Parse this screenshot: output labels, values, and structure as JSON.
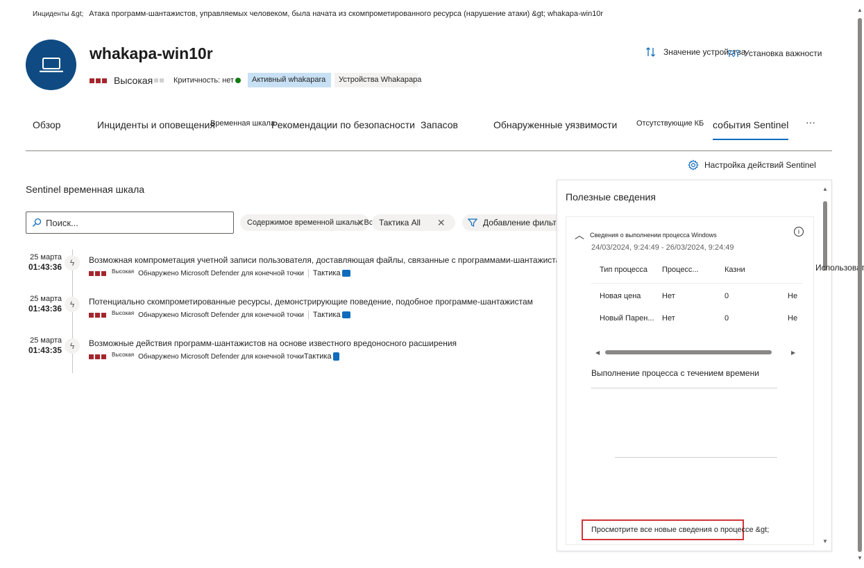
{
  "breadcrumb": {
    "root": "Инциденты &gt;",
    "path": "Атака программ-шантажистов, управляемых человеком, была начата из скомпрометированного ресурса (нарушение атаки) &gt; whakapa-win10r"
  },
  "device": {
    "name": "whakapa-win10r",
    "severity": "Высокая",
    "criticality": "Критичность: нет",
    "tag_active": "Активный whakapara",
    "tag_devices": "Устройства Whakapapa"
  },
  "actions": {
    "device_value": "Значение устройства",
    "set_importance": "Установка важности"
  },
  "tabs": [
    {
      "label": "Обзор"
    },
    {
      "label": "Инциденты и оповещения"
    },
    {
      "label": "Временная шкала"
    },
    {
      "label": "Рекомендации по безопасности"
    },
    {
      "label": "Запасов"
    },
    {
      "label": "Обнаруженные уязвимости"
    },
    {
      "label": "Отсутствующие КБ"
    },
    {
      "label": "события Sentinel"
    },
    {
      "label": "···"
    }
  ],
  "sentinel_settings": "Настройка действий Sentinel",
  "timeline": {
    "title": "Sentinel временная шкала",
    "search_placeholder": "Поиск...",
    "filter_content": "Содержимое временной шкалы: Все",
    "filter_tactic": "Тактика All",
    "add_filter": "Добавление фильтра",
    "entries": [
      {
        "date": "25 марта",
        "time": "01:43:36",
        "title": "Возможная компрометация учетной записи пользователя, доставляющая файлы, связанные с программами-шантажистами",
        "severity": "Высокая",
        "detected": "Обнаружено Microsoft Defender для конечной точки",
        "tactic": "Тактика"
      },
      {
        "date": "25 марта",
        "time": "01:43:36",
        "title": "Потенциально скомпрометированные ресурсы, демонстрирующие поведение, подобное программе-шантажистам",
        "severity": "Высокая",
        "detected": "Обнаружено Microsoft Defender для конечной точки",
        "tactic": "Тактика"
      },
      {
        "date": "25 марта",
        "time": "01:43:35",
        "title": "Возможные действия программ-шантажистов на основе известного вредоносного расширения",
        "severity": "Высокая",
        "detected": "Обнаружено Microsoft Defender для конечной точки",
        "tactic": "Тактика"
      }
    ]
  },
  "insights": {
    "title": "Полезные сведения",
    "card_title": "Сведения о выполнении процесса Windows",
    "range": "24/03/2024, 9:24:49 - 26/03/2024, 9:24:49",
    "columns": [
      "Тип процесса",
      "Процесс...",
      "Казни",
      "Использовать"
    ],
    "rows": [
      [
        "Новая цена",
        "Нет",
        "0",
        "Не"
      ],
      [
        "Новый Парен...",
        "Нет",
        "0",
        "Не"
      ]
    ],
    "chart_title": "Выполнение процесса с течением времени",
    "view_all": "Просмотрите все новые сведения о процессе &gt;"
  },
  "colors": {
    "accent": "#0f6cbd",
    "avatar": "#0f4b82",
    "severity_high": "#a4262c",
    "status_green": "#107c10",
    "highlight_box": "#d13438"
  }
}
